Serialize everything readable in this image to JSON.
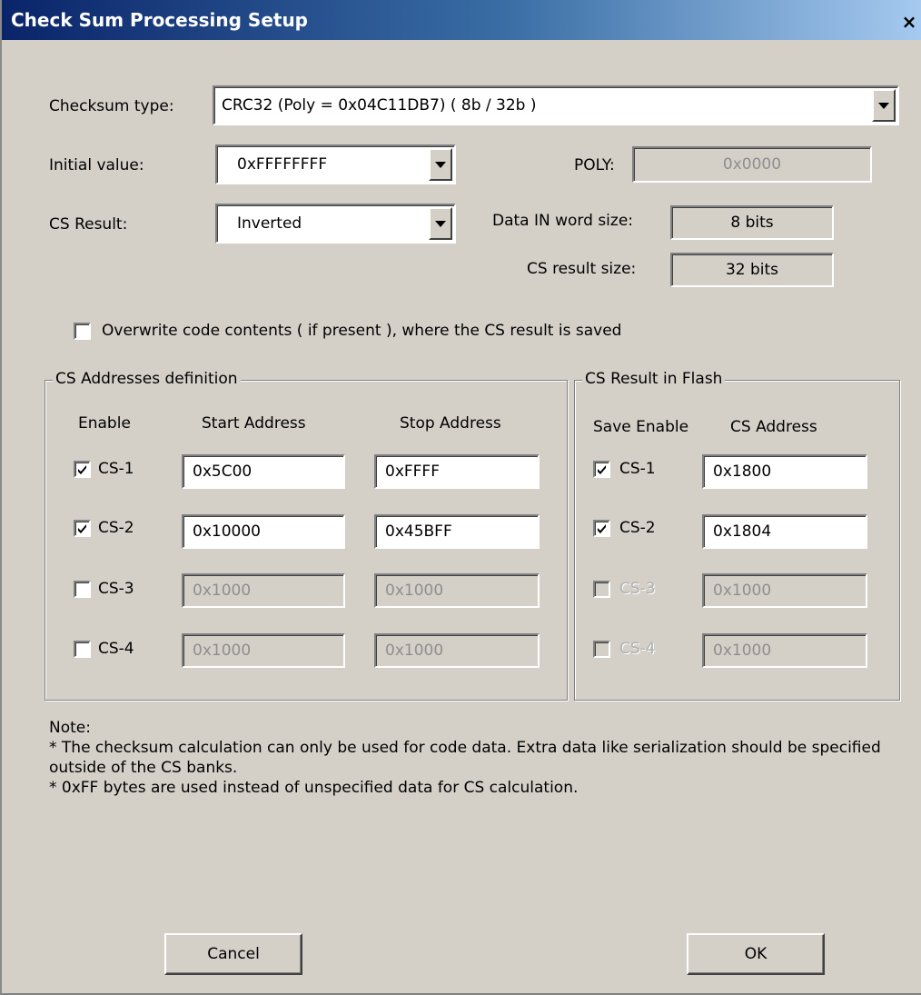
{
  "window": {
    "title": "Check Sum Processing Setup",
    "close_glyph": "×"
  },
  "checksum_type": {
    "label": "Checksum type:",
    "value": "CRC32 (Poly = 0x04C11DB7) ( 8b / 32b )"
  },
  "initial_value": {
    "label": "Initial value:",
    "value": "0xFFFFFFFF"
  },
  "poly": {
    "label": "POLY:",
    "value": "0x0000"
  },
  "cs_result": {
    "label": "CS Result:",
    "value": "Inverted"
  },
  "data_in_word_size": {
    "label": "Data IN word size:",
    "value": "8 bits"
  },
  "cs_result_size": {
    "label": "CS result size:",
    "value": "32 bits"
  },
  "overwrite": {
    "label": "Overwrite code contents ( if present ), where the CS result is saved",
    "checked": false
  },
  "addresses_group": {
    "title": "CS Addresses definition",
    "headers": {
      "enable": "Enable",
      "start": "Start Address",
      "stop": "Stop Address"
    },
    "rows": [
      {
        "label": "CS-1",
        "checked": true,
        "start": "0x5C00",
        "stop": "0xFFFF",
        "enabled": true
      },
      {
        "label": "CS-2",
        "checked": true,
        "start": "0x10000",
        "stop": "0x45BFF",
        "enabled": true
      },
      {
        "label": "CS-3",
        "checked": false,
        "start": "0x1000",
        "stop": "0x1000",
        "enabled": false
      },
      {
        "label": "CS-4",
        "checked": false,
        "start": "0x1000",
        "stop": "0x1000",
        "enabled": false
      }
    ]
  },
  "flash_group": {
    "title": "CS Result in Flash",
    "headers": {
      "save_enable": "Save Enable",
      "cs_address": "CS Address"
    },
    "rows": [
      {
        "label": "CS-1",
        "checked": true,
        "address": "0x1800",
        "enabled": true
      },
      {
        "label": "CS-2",
        "checked": true,
        "address": "0x1804",
        "enabled": true
      },
      {
        "label": "CS-3",
        "checked": false,
        "address": "0x1000",
        "enabled": false
      },
      {
        "label": "CS-4",
        "checked": false,
        "address": "0x1000",
        "enabled": false
      }
    ]
  },
  "note": {
    "heading": "Note:",
    "lines": [
      "* The checksum calculation can only be used for code data. Extra data like serialization should be specified outside of the CS banks.",
      "* 0xFF bytes are used instead of unspecified data for CS calculation."
    ]
  },
  "buttons": {
    "cancel": "Cancel",
    "ok": "OK"
  },
  "colors": {
    "face": "#d4d0c8",
    "title_start": "#0a246a",
    "title_end": "#a6caf0",
    "disabled_text": "#8e8e8e"
  },
  "icons": {
    "check": "check-icon",
    "dropdown": "chevron-down-icon",
    "close": "close-icon"
  }
}
